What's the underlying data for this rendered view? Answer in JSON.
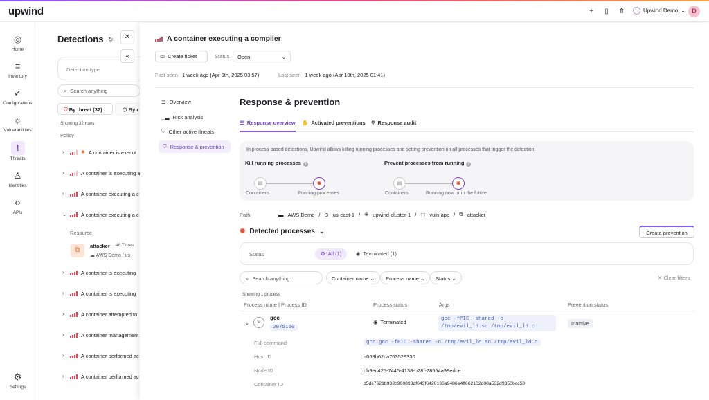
{
  "app": {
    "logo": "upwind",
    "org": "Upwind Demo",
    "avatar": "D"
  },
  "topbar_icons": [
    "plus-icon",
    "book-icon",
    "rocket-icon"
  ],
  "sidebar": [
    {
      "label": "Home",
      "icon": "◎"
    },
    {
      "label": "Inventory",
      "icon": "≡"
    },
    {
      "label": "Configurations",
      "icon": "✓"
    },
    {
      "label": "Vulnerabilities",
      "icon": "☼"
    },
    {
      "label": "Threats",
      "icon": "!"
    },
    {
      "label": "Identities",
      "icon": "♙"
    },
    {
      "label": "APIs",
      "icon": "‹›"
    },
    {
      "label": "Settings",
      "icon": "⚙"
    }
  ],
  "left": {
    "title": "Detections",
    "detection_type_placeholder": "Detection type",
    "search_placeholder": "Search anything",
    "tab_threat": "By threat (32)",
    "tab_other": "By r",
    "showing": "Showing 32 rows",
    "policy_header": "Policy",
    "rows": [
      {
        "text": "A container is execut",
        "sev": "low",
        "dot": true
      },
      {
        "text": "A container is executing a",
        "sev": "low"
      },
      {
        "text": "A container executing a c",
        "sev": "high"
      },
      {
        "text": "A container executing a c",
        "sev": "high",
        "open": true
      },
      {
        "text": "A container is executing",
        "sev": "high"
      },
      {
        "text": "A container is executing",
        "sev": "high"
      },
      {
        "text": "A container attempted to",
        "sev": "high"
      },
      {
        "text": "A container management",
        "sev": "high"
      },
      {
        "text": "A container performed ac",
        "sev": "high"
      },
      {
        "text": "A container performed ac",
        "sev": "high"
      }
    ],
    "resource_label": "Resource",
    "resource_name": "attacker",
    "resource_times": "48 Times",
    "resource_path": "AWS Demo / us"
  },
  "detail": {
    "title": "A container executing a compiler",
    "create_ticket": "Create ticket",
    "status_label": "Status",
    "status_value": "Open",
    "first_seen_k": "First seen",
    "first_seen_v": "1 week ago (Apr 9th, 2025 03:57)",
    "last_seen_k": "Last seen",
    "last_seen_v": "1 week ago (Apr 10th, 2025 01:41)",
    "nav": [
      "Overview",
      "Risk analysis",
      "Other active threats",
      "Response & prevention"
    ],
    "response_title": "Response & prevention",
    "tabs": [
      "Response overview",
      "Activated preventions",
      "Response audit"
    ],
    "info_text": "In process-based detections, Upwind allows killing running processes and setting prevention on all processes that trigger the detection.",
    "kill_heading": "Kill running processes",
    "prevent_heading": "Prevent processes from running",
    "kill_nodes": [
      "Containers",
      "Running processes"
    ],
    "prevent_nodes": [
      "Containers",
      "Running now or in the future"
    ],
    "path_label": "Path",
    "path": [
      "AWS Demo",
      "us-east-1",
      "upwind-cluster-1",
      "vuln-app",
      "attacker"
    ],
    "detected_title": "Detected processes",
    "create_prevention": "Create prevention",
    "status_filter_label": "Status",
    "status_all": "All (1)",
    "status_terminated": "Terminated (1)",
    "search_placeholder": "Search anything",
    "filters": [
      "Container name",
      "Process name",
      "Status"
    ],
    "clear_filters": "Clear filters",
    "showing": "Showing 1 process",
    "columns": [
      "Process name | Process ID",
      "Process status",
      "Args",
      "Prevention status"
    ],
    "process": {
      "name": "gcc",
      "pid": "2975160",
      "status": "Terminated",
      "args": "gcc -fPIC -shared -o /tmp/evil_ld.so /tmp/evil_ld.c",
      "prevention": "Inactive"
    },
    "details": [
      {
        "k": "Full command",
        "v": "gcc gcc -fPIC -shared -o /tmp/evil_ld.so /tmp/evil_ld.c",
        "code": true
      },
      {
        "k": "Host ID",
        "v": "i-069b62ca763529330"
      },
      {
        "k": "Node ID",
        "v": "db9ec425-7445-4138-b28f-78554a99edce"
      },
      {
        "k": "Container ID",
        "v": "d5dc7621b933b900893df643f6420136a9486e4ff662102d08a532d9350bcc58"
      }
    ]
  }
}
